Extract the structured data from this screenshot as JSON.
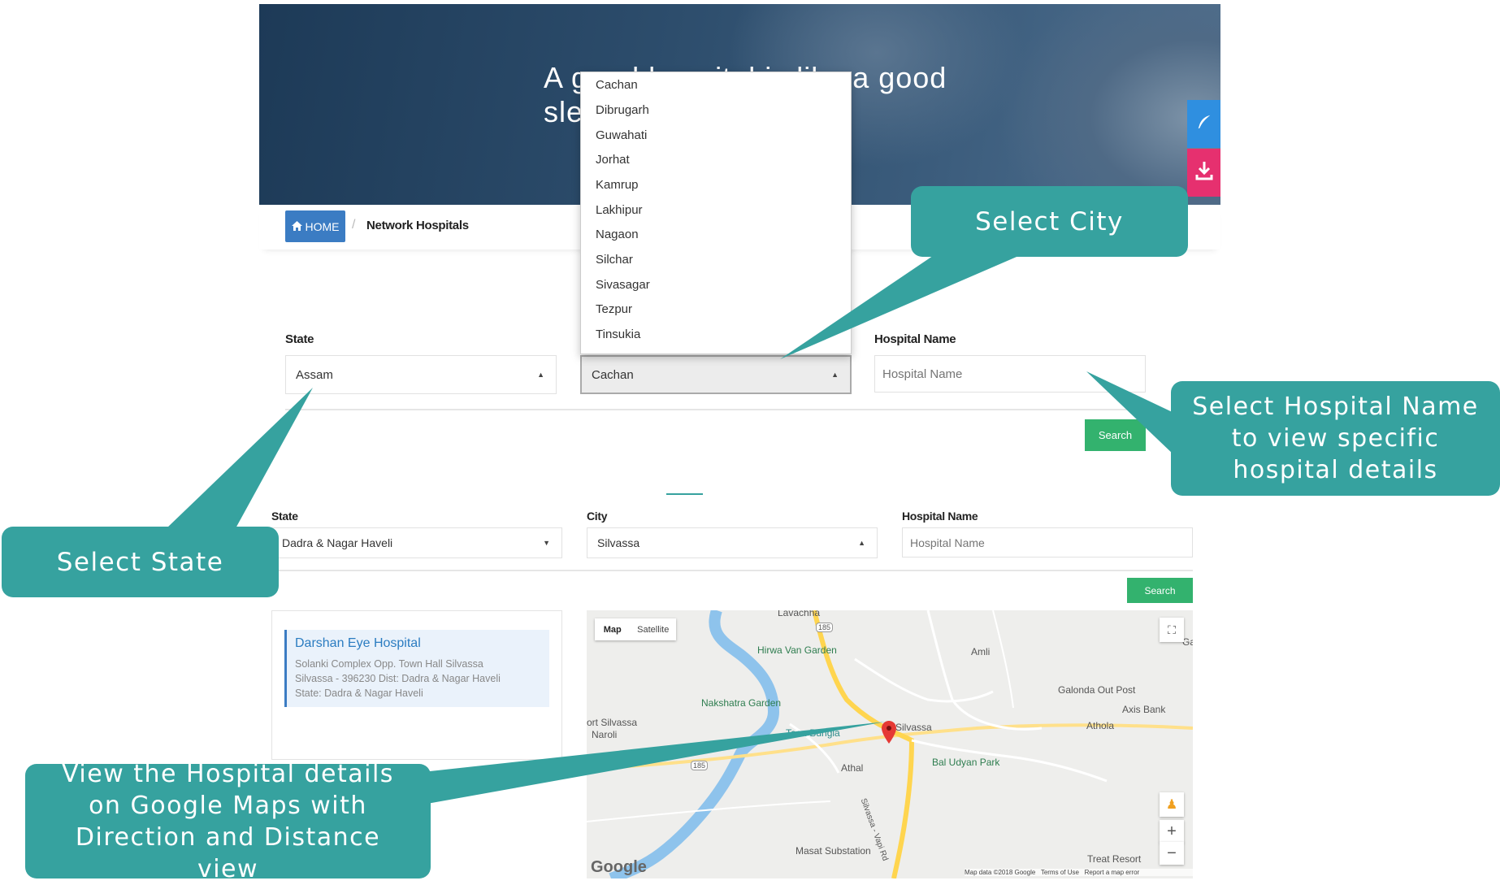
{
  "hero": {
    "title": "A good hospital is like a good sleep"
  },
  "breadcrumb": {
    "home_label": "HOME",
    "separator": "/",
    "current": "Network Hospitals"
  },
  "form1": {
    "state_label": "State",
    "state_value": "Assam",
    "city_value": "Cachan",
    "hospital_label": "Hospital Name",
    "hospital_placeholder": "Hospital Name",
    "search_label": "Search"
  },
  "dropdown": {
    "options": [
      "Cachan",
      "Dibrugarh",
      "Guwahati",
      "Jorhat",
      "Kamrup",
      "Lakhipur",
      "Nagaon",
      "Silchar",
      "Sivasagar",
      "Tezpur",
      "Tinsukia"
    ]
  },
  "form2": {
    "state_label": "State",
    "state_value": "Dadra & Nagar Haveli",
    "city_label": "City",
    "city_value": "Silvassa",
    "hospital_label": "Hospital Name",
    "hospital_placeholder": "Hospital Name",
    "search_label": "Search"
  },
  "result": {
    "name": "Darshan Eye Hospital",
    "line1": "Solanki Complex Opp. Town Hall Silvassa",
    "line2": "Silvassa - 396230 Dist: Dadra & Nagar Haveli",
    "line3": "State: Dadra & Nagar Haveli"
  },
  "map": {
    "tab_map": "Map",
    "tab_satellite": "Satellite",
    "labels": {
      "lavachha": "Lavachha",
      "hirwa": "Hirwa Van Garden",
      "amli": "Amli",
      "galonda": "Galonda Out Post",
      "axis": "Axis Bank",
      "nakshatra": "Nakshatra Garden",
      "fort": "ort Silvassa",
      "naroli": "Naroli",
      "teen": "Teen Bungla",
      "silvassa": "Silvassa",
      "athola": "Athola",
      "athal": "Athal",
      "baludyan": "Bal Udyan Park",
      "masat": "Masat Substation",
      "treat": "Treat Resort",
      "ga": "Ga",
      "route185a": "185",
      "route185b": "185",
      "road": "Silvassa - Vapi Rd"
    },
    "zoom_in": "+",
    "zoom_out": "−",
    "google": "Google",
    "attribution": "Map data ©2018 Google   Terms of Use   Report a map error"
  },
  "callouts": {
    "city": "Select City",
    "hospital": "Select Hospital Name to view specific hospital details",
    "state": "Select State",
    "map": "View the Hospital details on Google Maps with Direction and Distance view"
  },
  "colors": {
    "callout": "#36a29f",
    "primary": "#3b7cc3",
    "search": "#33b26e",
    "download": "#e6306f",
    "share": "#2f8fe0"
  },
  "icons": {
    "home": "home-icon",
    "share": "feather-icon",
    "download": "download-icon",
    "pin": "map-pin-icon",
    "fullscreen": "fullscreen-icon",
    "pegman": "pegman-icon"
  }
}
